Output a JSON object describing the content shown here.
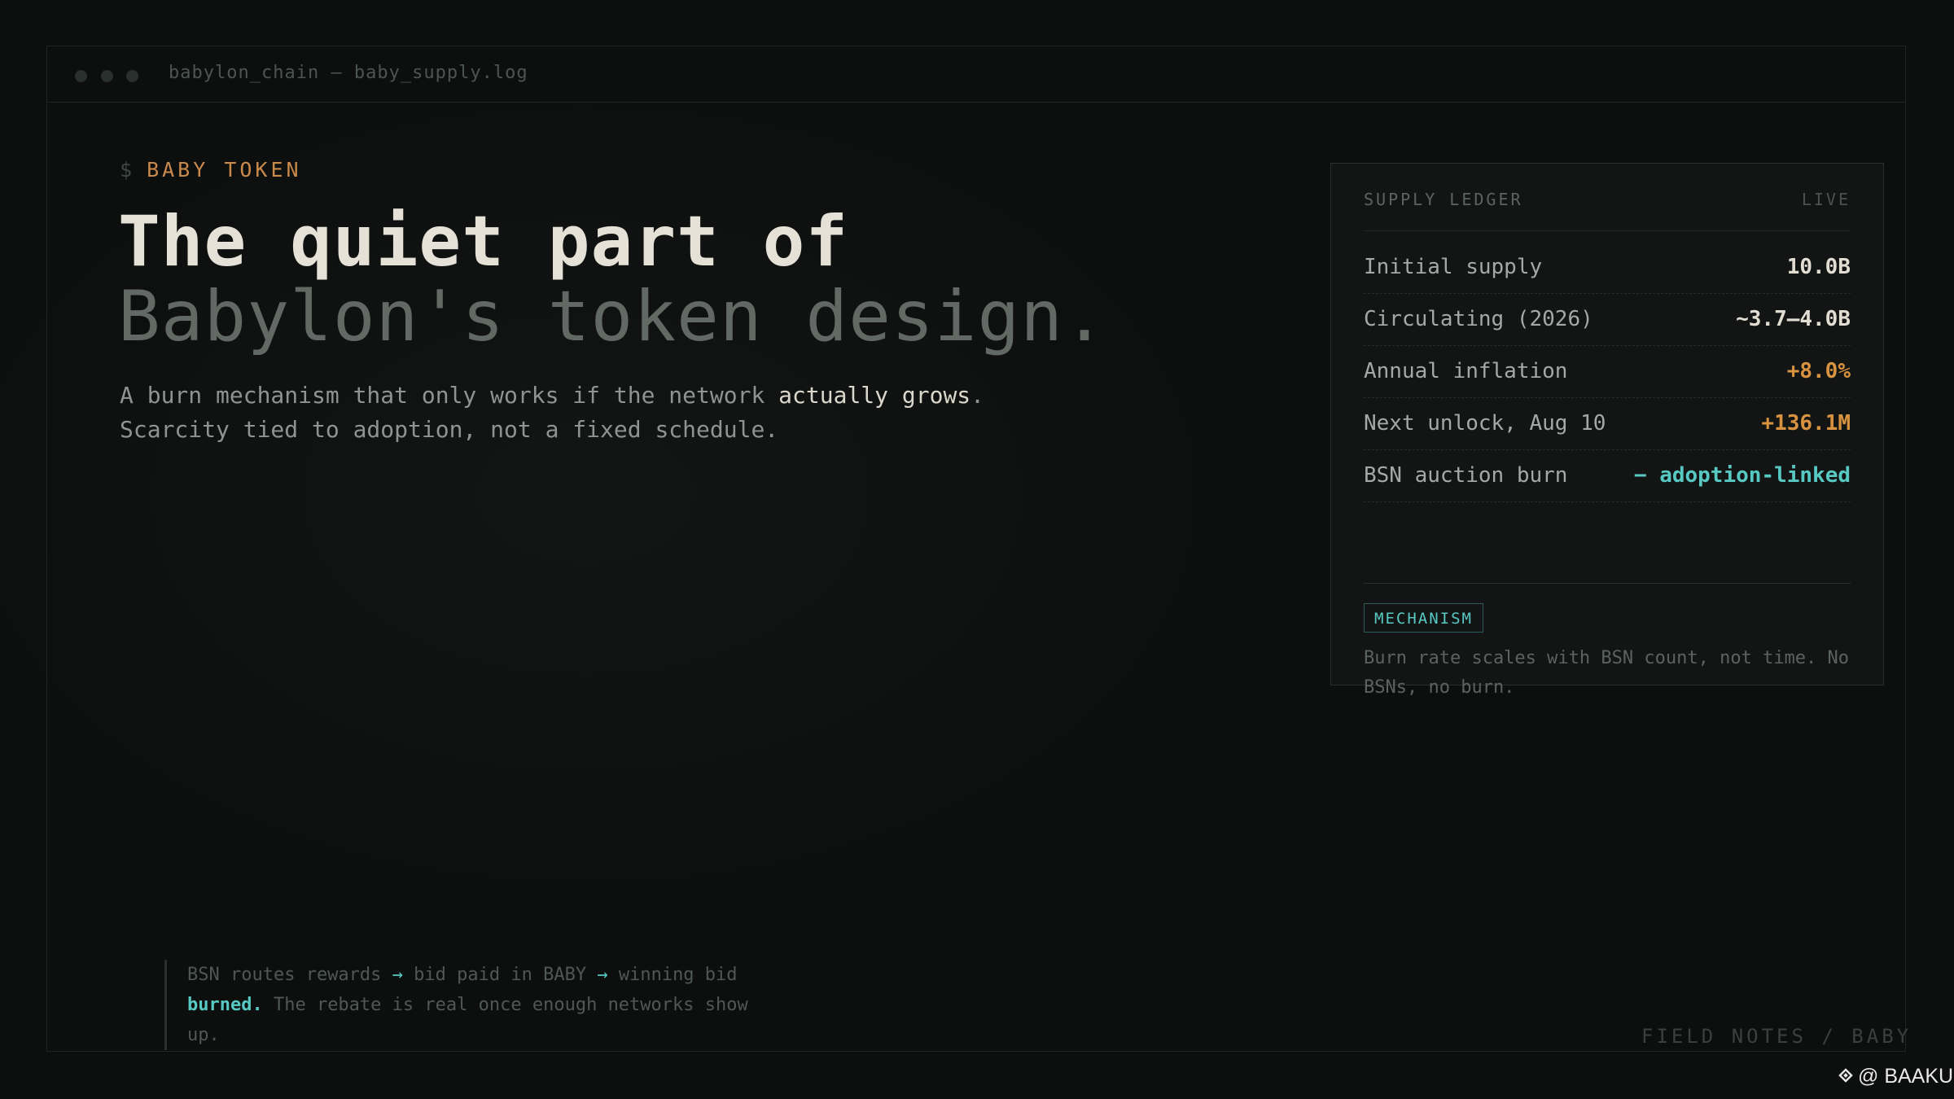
{
  "window": {
    "title": "babylon_chain — baby_supply.log"
  },
  "prompt": {
    "symbol": "$",
    "tag": "BABY TOKEN"
  },
  "headline": {
    "line1": "The quiet part of",
    "line2": "Babylon's token design."
  },
  "subtitle": {
    "line1_pre": "A burn mechanism that only works if the network ",
    "line1_highlight": "actually grows",
    "line1_post": ".",
    "line2": "Scarcity tied to adoption, not a fixed schedule."
  },
  "ledger": {
    "title": "SUPPLY LEDGER",
    "status": "LIVE",
    "rows": [
      {
        "label": "Initial supply",
        "value": "10.0B",
        "color": "#e2ddd2"
      },
      {
        "label": "Circulating (2026)",
        "value": "~3.7–4.0B",
        "color": "#e2ddd2"
      },
      {
        "label": "Annual inflation",
        "value": "+8.0%",
        "color": "#d9923f"
      },
      {
        "label": "Next unlock, Aug 10",
        "value": "+136.1M",
        "color": "#d9923f"
      },
      {
        "label": "BSN auction burn",
        "value": "− adoption-linked",
        "color": "#57c9c2"
      }
    ],
    "badge": "MECHANISM",
    "mechanism_text": "Burn rate scales with BSN count, not time. No BSNs, no burn."
  },
  "note": {
    "part1": "BSN routes rewards ",
    "arrow": "→",
    "part2": " bid paid in BABY ",
    "part3": " winning bid ",
    "burned": "burned.",
    "part4": " The rebate is real once enough networks show up."
  },
  "footer": "FIELD NOTES / BABY",
  "watermark": {
    "text": "@ BAAKU",
    "icon": "binance-square-icon"
  },
  "colors": {
    "accent_orange": "#c8894a",
    "accent_teal": "#57c9c2",
    "background": "#0d0f0e"
  }
}
